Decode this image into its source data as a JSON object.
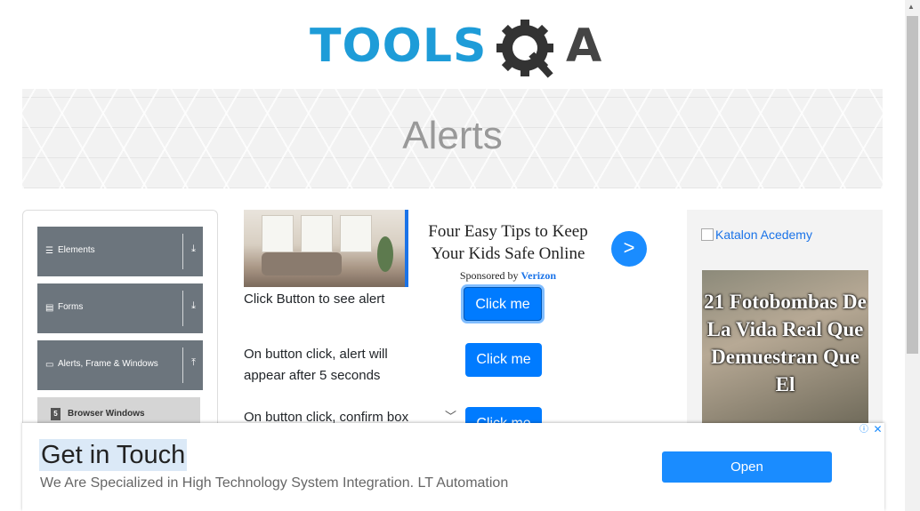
{
  "logo": {
    "text": "TOOLS",
    "text_suffix": "A",
    "brand_color": "#1e9cd8"
  },
  "page": {
    "title": "Alerts"
  },
  "sidebar": {
    "groups": [
      {
        "icon": "hamburger-icon",
        "label": "Elements",
        "arrow": "download-arrow-icon"
      },
      {
        "icon": "form-icon",
        "label": "Forms",
        "arrow": "download-arrow-icon"
      },
      {
        "icon": "window-icon",
        "label": "Alerts, Frame & Windows",
        "arrow": "upload-arrow-icon"
      }
    ],
    "subitems": [
      {
        "icon": "html5-icon",
        "label": "Browser Windows"
      }
    ]
  },
  "ad_top": {
    "title": "Four Easy Tips to Keep Your Kids Safe Online",
    "sponsor_prefix": "Sponsored by",
    "sponsor_name": "Verizon",
    "go_label": ">"
  },
  "alerts": [
    {
      "label": "Click Button to see alert",
      "button": "Click me"
    },
    {
      "label": "On button click, alert will appear after 5 seconds",
      "button": "Click me"
    },
    {
      "label": "On button click, confirm box",
      "button": "Click me"
    }
  ],
  "right_ad": {
    "link_text": "Katalon Acedemy",
    "image_text": "21 Fotobombas De La Vida Real Que Demuestran Que El"
  },
  "bottom_ad": {
    "title": "Get in Touch",
    "subtitle": "We Are Specialized in High Technology System Integration. LT Automation",
    "button": "Open",
    "ad_choice": "ⓘ",
    "close": "✕"
  },
  "colors": {
    "primary": "#007bff",
    "sidebar_group": "#6c757d",
    "logo_blue": "#1e9cd8"
  }
}
